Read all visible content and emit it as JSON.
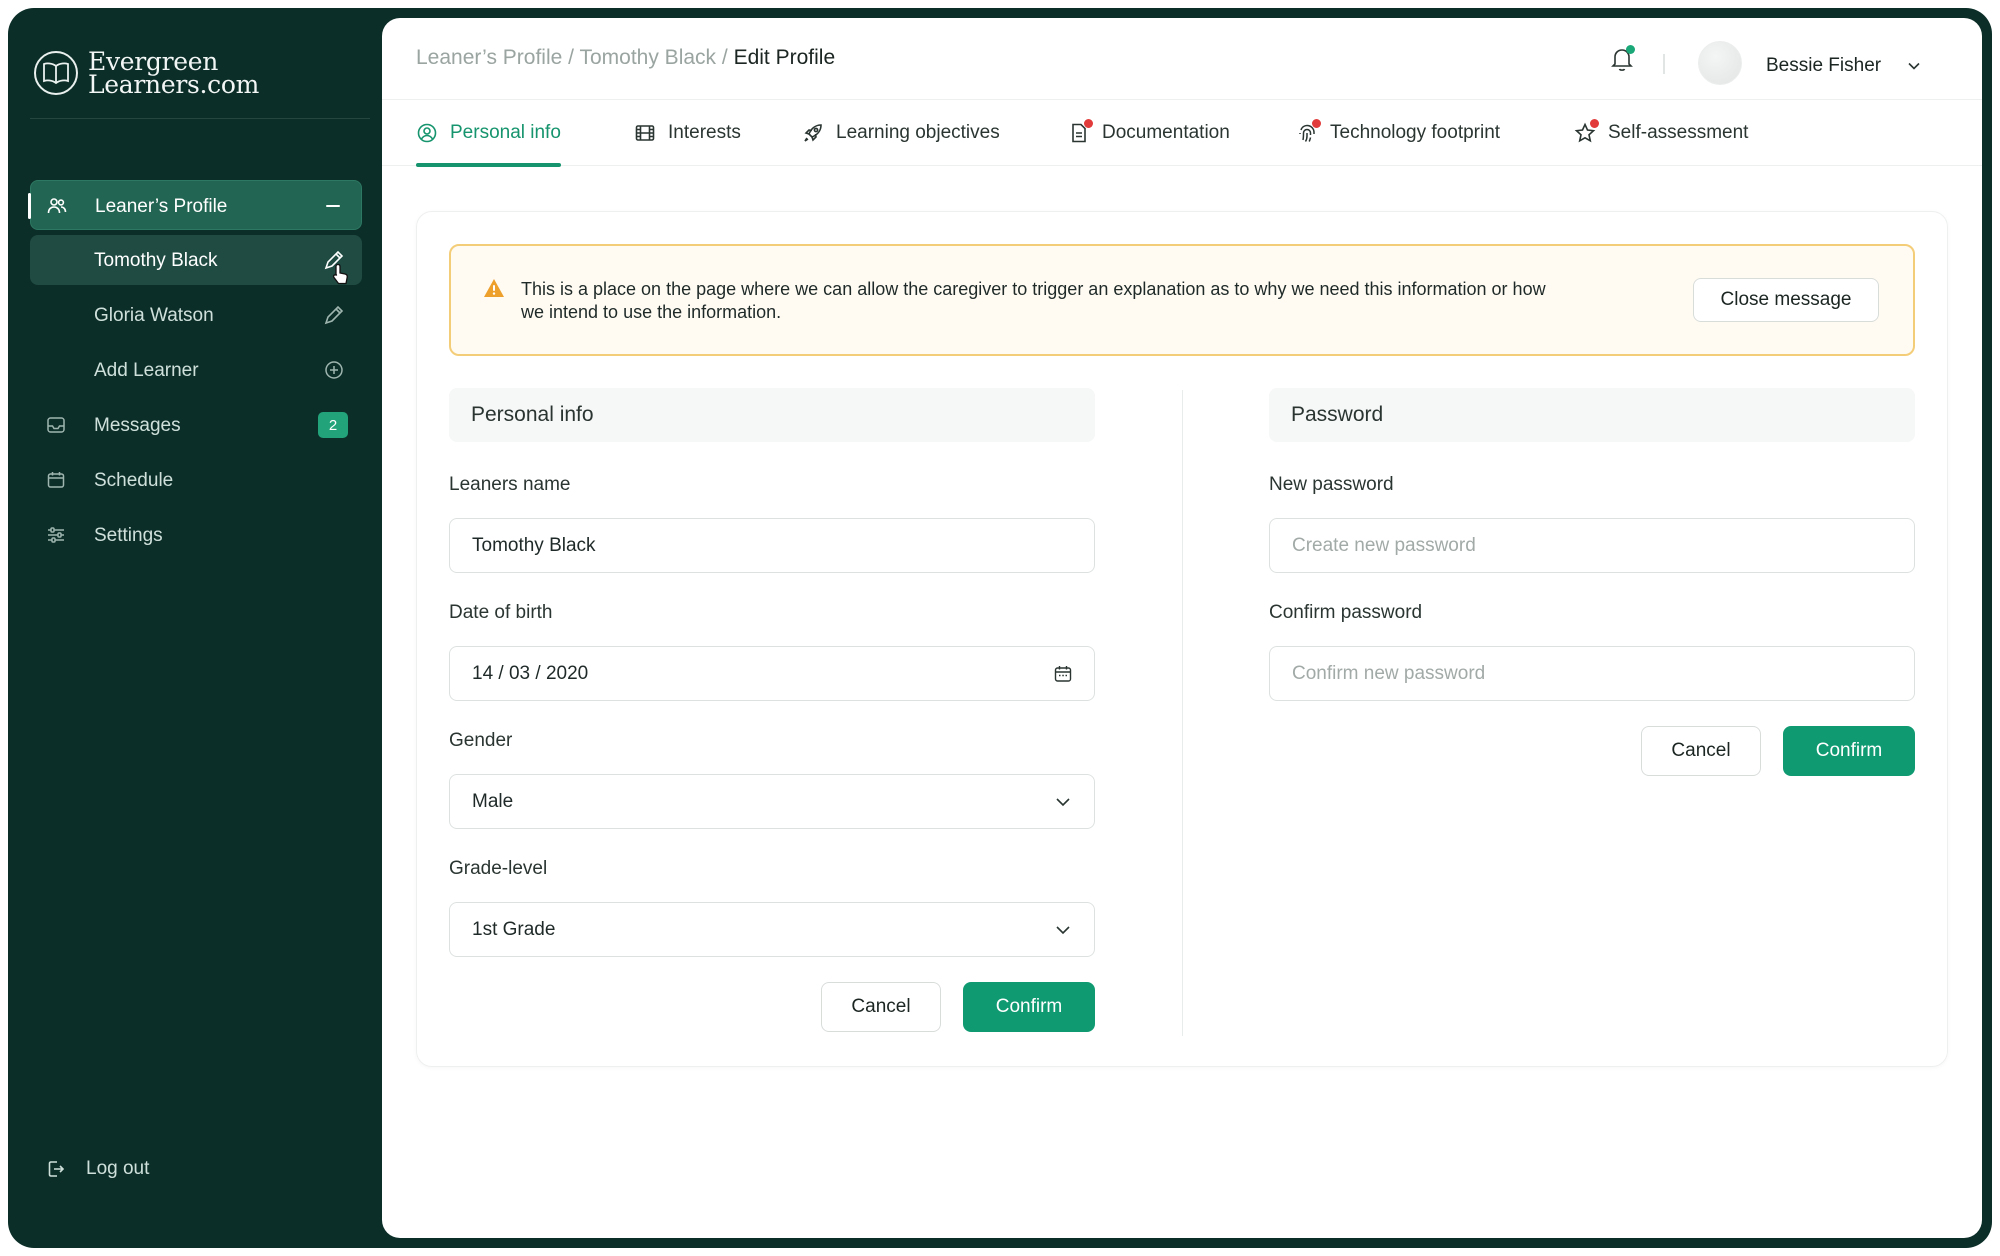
{
  "brand": {
    "line1": "Evergreen",
    "line2": "Learners.com"
  },
  "sidebar": {
    "items": [
      {
        "label": "Leaner’s Profile"
      },
      {
        "label": "Tomothy Black"
      },
      {
        "label": "Gloria Watson"
      },
      {
        "label": "Add Learner"
      },
      {
        "label": "Messages",
        "badge": "2"
      },
      {
        "label": "Schedule"
      },
      {
        "label": "Settings"
      }
    ],
    "logout": "Log out"
  },
  "header": {
    "breadcrumb": [
      "Leaner’s Profile",
      "Tomothy Black",
      "Edit Profile"
    ],
    "separator": "/",
    "user_name": "Bessie Fisher"
  },
  "tabs": [
    {
      "label": "Personal info",
      "icon": "user-circle-icon",
      "active": true
    },
    {
      "label": "Interests",
      "icon": "film-icon"
    },
    {
      "label": "Learning objectives",
      "icon": "rocket-icon"
    },
    {
      "label": "Documentation",
      "icon": "document-icon",
      "alert": true
    },
    {
      "label": "Technology footprint",
      "icon": "fingerprint-icon",
      "alert": true
    },
    {
      "label": "Self-assessment",
      "icon": "star-icon",
      "alert": true
    }
  ],
  "notice": {
    "text": "This is a place on the page where we can allow the caregiver to trigger an explanation as to why we need this information or how we intend to use the information.",
    "close_label": "Close message"
  },
  "personal": {
    "title": "Personal info",
    "name_label": "Leaners name",
    "name_value": "Tomothy Black",
    "dob_label": "Date of birth",
    "dob_value": "14 / 03 / 2020",
    "gender_label": "Gender",
    "gender_value": "Male",
    "grade_label": "Grade-level",
    "grade_value": "1st Grade",
    "cancel": "Cancel",
    "confirm": "Confirm"
  },
  "password": {
    "title": "Password",
    "new_label": "New password",
    "new_placeholder": "Create new password",
    "confirm_label": "Confirm password",
    "confirm_placeholder": "Confirm new password",
    "cancel": "Cancel",
    "confirm": "Confirm"
  },
  "colors": {
    "sidebar_bg": "#0c2e28",
    "accent": "#109a72",
    "warning": "#f4cd79",
    "alert": "#e23b3b"
  }
}
